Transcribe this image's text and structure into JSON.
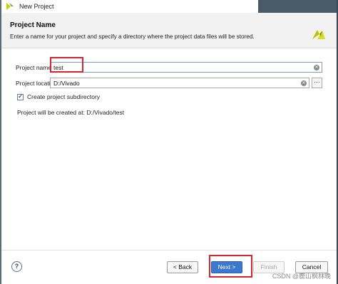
{
  "window": {
    "title": "New Project"
  },
  "header": {
    "title": "Project Name",
    "description": "Enter a name for your project and specify a directory where the project data files will be stored."
  },
  "form": {
    "project_name_label": "Project name:",
    "project_name_value": "test",
    "project_location_label": "Project location:",
    "project_location_value": "D:/Vivado",
    "browse_label": "···",
    "create_subdir_label": "Create project subdirectory",
    "create_subdir_checked": true,
    "created_at_text": "Project will be created at: D:/Vivado/test"
  },
  "footer": {
    "help_label": "?",
    "back_label": "< Back",
    "next_label": "Next >",
    "finish_label": "Finish",
    "cancel_label": "Cancel",
    "watermark": "CSDN @鹿山枫林晚"
  },
  "icons": {
    "app": "vivado-logo-icon",
    "header_logo": "vivado-logo-icon",
    "clear": "clear-icon",
    "help": "help-icon"
  },
  "colors": {
    "accent": "#3c78cf",
    "highlight": "#d9232e",
    "logo": "#c8d200"
  }
}
